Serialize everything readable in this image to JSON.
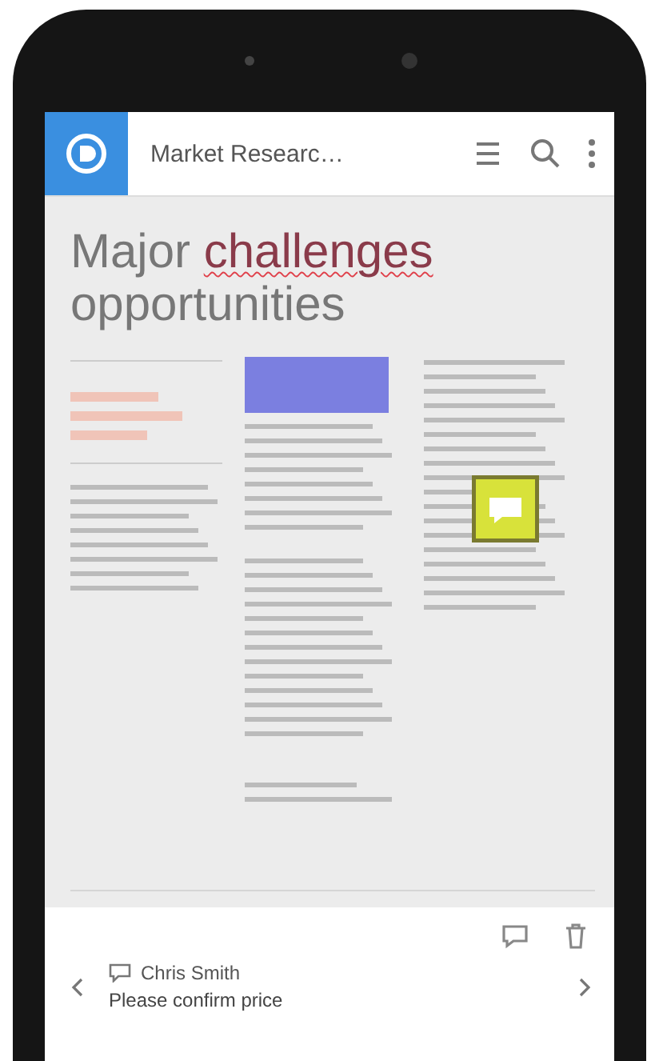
{
  "app_bar": {
    "title": "Market Researc…"
  },
  "document": {
    "heading_words": [
      {
        "text": "Major",
        "marked": false
      },
      {
        "text": "challenges",
        "marked": true
      }
    ],
    "heading_line_2": "opportunities"
  },
  "comment": {
    "author": "Chris Smith",
    "text": "Please confirm price"
  }
}
